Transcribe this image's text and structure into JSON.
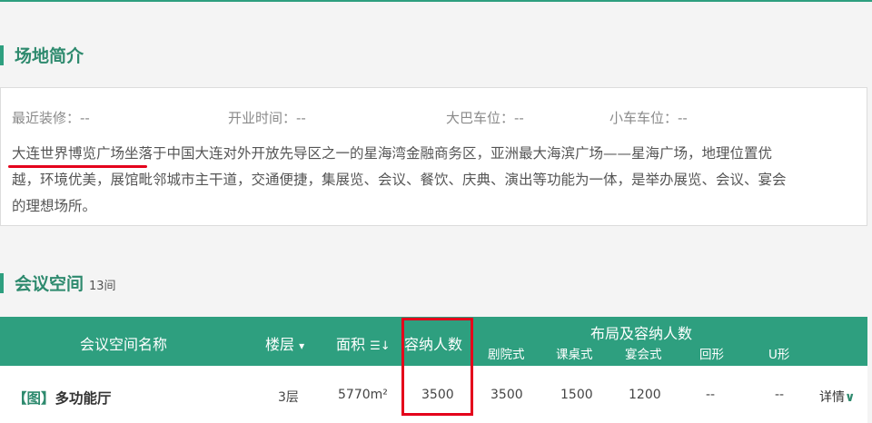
{
  "intro": {
    "title": "场地简介",
    "meta": [
      {
        "label": "最近装修：",
        "value": "--"
      },
      {
        "label": "开业时间：",
        "value": "--"
      },
      {
        "label": "大巴车位：",
        "value": "--"
      },
      {
        "label": "小车车位：",
        "value": "--"
      }
    ],
    "description_line1": "大连世界博览广场坐落于中国大连对外开放先导区之一的星海湾金融商务区，亚洲最大海滨广场——星海广场，地理位置优",
    "description_line2": "越，环境优美，展馆毗邻城市主干道，交通便捷，集展览、会议、餐饮、庆典、演出等功能为一体，是举办展览、会议、宴会",
    "description_line3": "的理想场所。"
  },
  "meeting": {
    "title": "会议空间",
    "count": "13间",
    "headers": {
      "name": "会议空间名称",
      "floor": "楼层",
      "floor_arrow": "▾",
      "area": "面积",
      "area_icon": "☰↓",
      "capacity": "容纳人数",
      "layout_group": "布局及容纳人数",
      "layouts": [
        "剧院式",
        "课桌式",
        "宴会式",
        "回形",
        "U形"
      ]
    },
    "rows": [
      {
        "image_tag": "【图】",
        "name": "多功能厅",
        "floor": "3层",
        "area": "5770m²",
        "capacity": "3500",
        "theater": "3500",
        "classroom": "1500",
        "banquet": "1200",
        "hollow": "--",
        "u_shape": "--",
        "detail": "详情",
        "detail_icon": "∨"
      }
    ]
  },
  "colors": {
    "accent": "#2e9f7f",
    "highlight": "#e4001b"
  }
}
